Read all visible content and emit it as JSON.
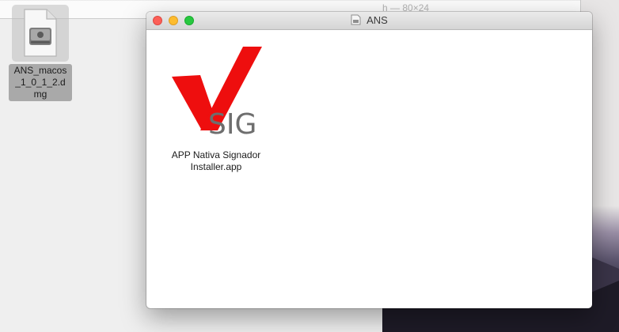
{
  "terminal": {
    "title": "h — 80×24"
  },
  "desktop": {
    "dmg_file": {
      "label": "ANS_macos_1_0_1_2.dmg",
      "icon": "disk-image-icon"
    }
  },
  "finder": {
    "title": "ANS",
    "title_icon": "disk-image-icon",
    "items": [
      {
        "label": "APP Nativa Signador Installer.app",
        "icon": "vsig-app-icon",
        "icon_text": "SIG"
      }
    ]
  },
  "colors": {
    "close": "#fc5f57",
    "minimize": "#fdbc2e",
    "maximize": "#28c840",
    "app_check": "#ee0e0e"
  }
}
